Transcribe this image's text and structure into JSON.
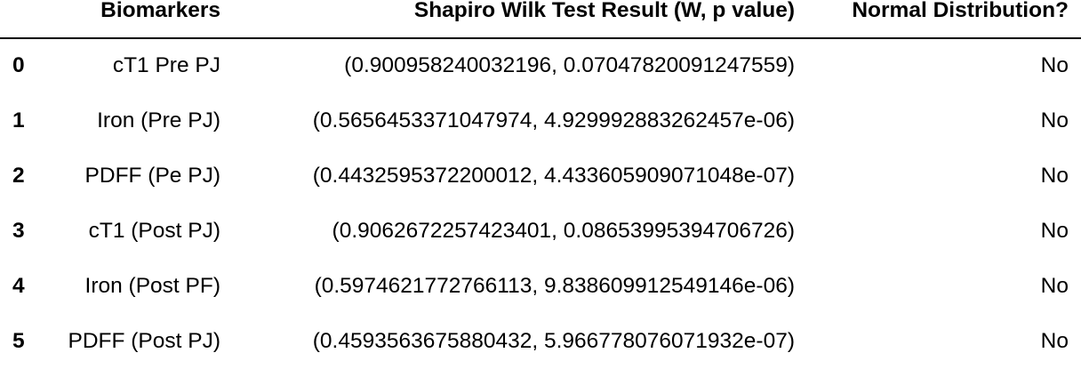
{
  "table": {
    "index_header": "",
    "columns": [
      "Biomarkers",
      "Shapiro Wilk Test Result (W, p value)",
      "Normal Distribution?"
    ],
    "rows": [
      {
        "index": "0",
        "biomarker": "cT1 Pre PJ",
        "result": "(0.900958240032196, 0.07047820091247559)",
        "normal": "No"
      },
      {
        "index": "1",
        "biomarker": "Iron (Pre PJ)",
        "result": "(0.5656453371047974, 4.929992883262457e-06)",
        "normal": "No"
      },
      {
        "index": "2",
        "biomarker": "PDFF (Pe PJ)",
        "result": "(0.4432595372200012, 4.433605909071048e-07)",
        "normal": "No"
      },
      {
        "index": "3",
        "biomarker": "cT1 (Post PJ)",
        "result": "(0.9062672257423401, 0.08653995394706726)",
        "normal": "No"
      },
      {
        "index": "4",
        "biomarker": "Iron (Post PF)",
        "result": "(0.5974621772766113, 9.838609912549146e-06)",
        "normal": "No"
      },
      {
        "index": "5",
        "biomarker": "PDFF (Post PJ)",
        "result": "(0.4593563675880432, 5.966778076071932e-07)",
        "normal": "No"
      }
    ]
  }
}
